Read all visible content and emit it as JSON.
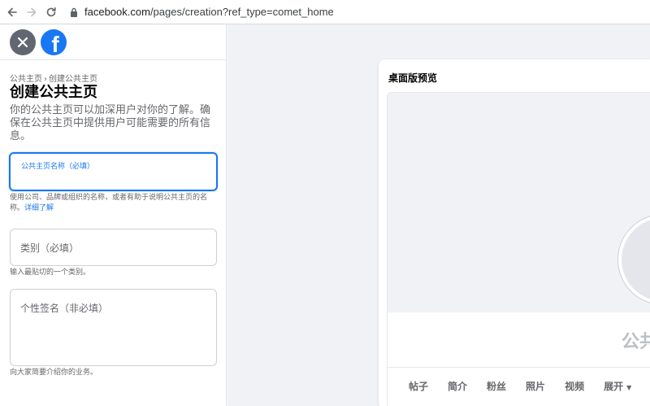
{
  "browser": {
    "url_host": "facebook.com",
    "url_path": "/pages/creation?ref_type=comet_home",
    "back_icon": "arrow-left-icon",
    "forward_icon": "arrow-right-icon",
    "reload_icon": "reload-icon",
    "lock_icon": "lock-icon"
  },
  "panel": {
    "close_icon": "close-icon",
    "logo": "facebook-logo",
    "breadcrumb": {
      "parent": "公共主页",
      "separator": "›",
      "current": "创建公共主页"
    },
    "title": "创建公共主页",
    "description": "你的公共主页可以加深用户对你的了解。确保在公共主页中提供用户可能需要的所有信息。",
    "name_field": {
      "label": "公共主页名称（必填）",
      "value": "",
      "helper": "使用公司、品牌或组织的名称，或者有助于说明公共主页的名称。",
      "helper_link": "详细了解"
    },
    "category_field": {
      "placeholder": "类别（必填）",
      "helper": "输入最贴切的一个类别。"
    },
    "bio_field": {
      "placeholder": "个性签名（非必填）",
      "helper": "向大家简要介绍你的业务。"
    }
  },
  "preview": {
    "title": "桌面版预览",
    "page_name": "公共",
    "tabs": [
      "帖子",
      "简介",
      "粉丝",
      "照片",
      "视频",
      "展开"
    ],
    "more_caret": "▼"
  },
  "colors": {
    "accent": "#1877f2",
    "background": "#f0f2f5",
    "text_secondary": "#65676b"
  }
}
